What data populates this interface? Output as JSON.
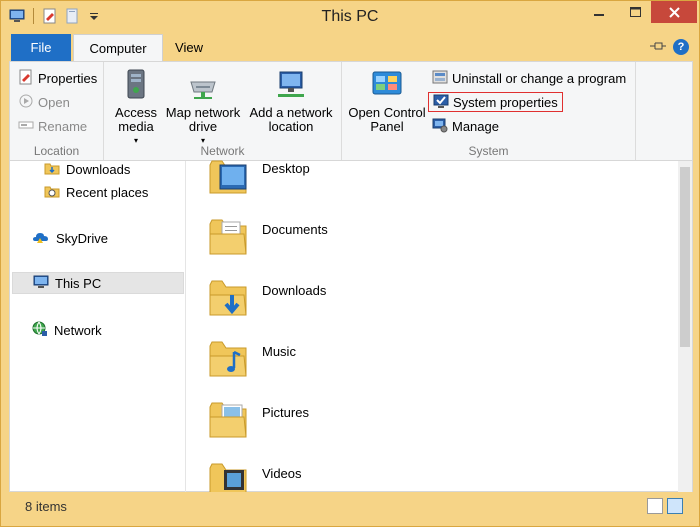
{
  "window": {
    "title": "This PC"
  },
  "quick_access": {
    "icons": [
      "computer-icon",
      "properties-icon",
      "new-folder-icon",
      "dropdown-icon"
    ]
  },
  "tabs": [
    {
      "label": "File"
    },
    {
      "label": "Computer"
    },
    {
      "label": "View"
    }
  ],
  "ribbon": {
    "location": {
      "label": "Location",
      "properties": "Properties",
      "open": "Open",
      "rename": "Rename"
    },
    "network": {
      "label": "Network",
      "access_media": "Access media",
      "map_network_drive": "Map network drive",
      "add_network_location": "Add a network location"
    },
    "system": {
      "label": "System",
      "open_control_panel": "Open Control Panel",
      "uninstall": "Uninstall or change a program",
      "system_properties": "System properties",
      "manage": "Manage"
    }
  },
  "nav": {
    "items": [
      {
        "label": "Downloads"
      },
      {
        "label": "Recent places"
      },
      {
        "label": "SkyDrive"
      },
      {
        "label": "This PC"
      },
      {
        "label": "Network"
      }
    ]
  },
  "files": [
    {
      "label": "Desktop"
    },
    {
      "label": "Documents"
    },
    {
      "label": "Downloads"
    },
    {
      "label": "Music"
    },
    {
      "label": "Pictures"
    },
    {
      "label": "Videos"
    }
  ],
  "status": {
    "items_count": "8 items"
  },
  "colors": {
    "title_bar": "#f6d487",
    "file_tab": "#1f6fc6",
    "close_button": "#c7483b",
    "highlight_border": "#e03030"
  }
}
